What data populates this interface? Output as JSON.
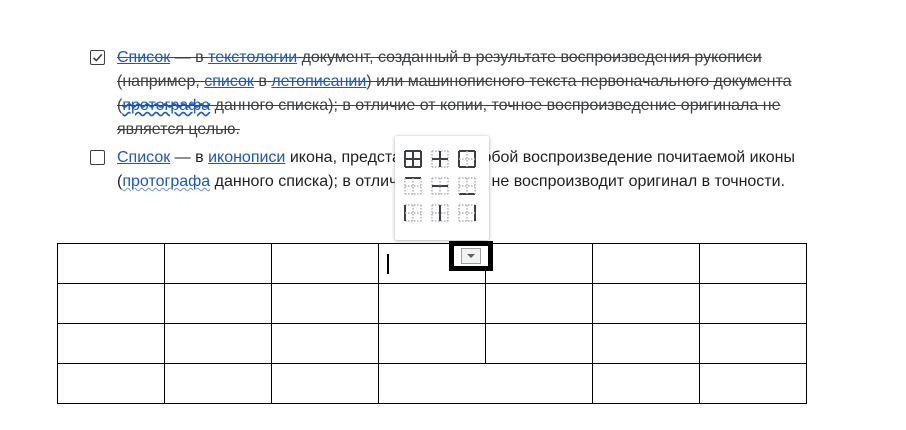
{
  "items": [
    {
      "checked": true,
      "parts": [
        {
          "t": "Список",
          "link": true
        },
        {
          "t": " — в "
        },
        {
          "t": "текстологии",
          "link": true
        },
        {
          "t": " документ, созданный в результате воспроизведения рукописи (например, "
        },
        {
          "t": "список",
          "link": true
        },
        {
          "t": " в "
        },
        {
          "t": "летописании",
          "link": true
        },
        {
          "t": ") или машинописного текста первоначального документа ("
        },
        {
          "t": "протографа",
          "link": true,
          "wavy": true
        },
        {
          "t": " данного списка); в отличие от копии, точное воспроизведение оригинала не является целью."
        }
      ]
    },
    {
      "checked": false,
      "parts": [
        {
          "t": "Список",
          "link": true
        },
        {
          "t": " — в "
        },
        {
          "t": "иконописи",
          "link": true
        },
        {
          "t": " икона, представляющая собой воспроизведение почитаемой иконы ("
        },
        {
          "t": "протографа",
          "link": true,
          "wavy": true
        },
        {
          "t": " данного списка); в отличие от копии, не воспроизводит оригинал в точности."
        }
      ]
    }
  ],
  "table": {
    "rows": 4,
    "cols": 7
  },
  "border_menu": {
    "icons": [
      "all-borders-icon",
      "inner-borders-icon",
      "outer-borders-icon",
      "top-border-icon",
      "horizontal-inner-border-icon",
      "bottom-border-icon",
      "left-border-icon",
      "vertical-inner-border-icon",
      "right-border-icon"
    ]
  },
  "colors": {
    "link": "#1a56c4",
    "highlight_box": "#000000"
  }
}
